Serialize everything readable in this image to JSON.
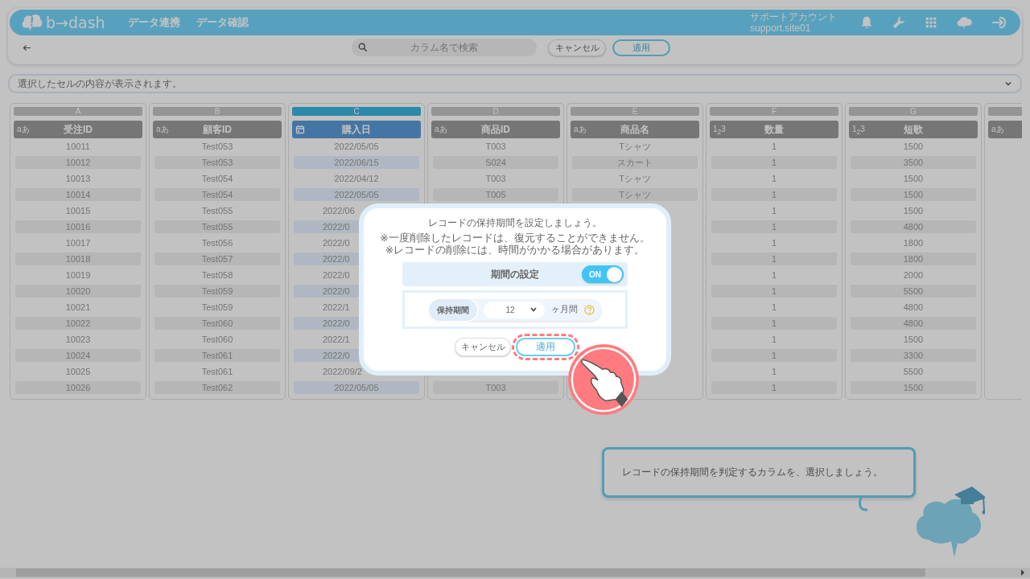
{
  "app_bar": {
    "logo": "b→dash",
    "nav": [
      {
        "label": "データ連携"
      },
      {
        "label": "データ確認"
      }
    ],
    "account": {
      "name": "サポートアカウント",
      "id": "support.site01"
    }
  },
  "toolbar": {
    "search": {
      "placeholder": "カラム名で検索"
    },
    "buttons": [
      {
        "label": "キャンセル",
        "kind": "secondary"
      },
      {
        "label": "適用",
        "kind": "primary"
      }
    ]
  },
  "cell_preview": {
    "placeholder": "選択したセルの内容が表示されます。"
  },
  "columns": [
    {
      "letter": "A",
      "name": "受注ID",
      "kind": "text",
      "type_label": "aあ",
      "selected": false,
      "cells": [
        "10011",
        "10012",
        "10013",
        "10014",
        "10015",
        "10016",
        "10017",
        "10018",
        "10019",
        "10020",
        "10021",
        "10022",
        "10023",
        "10024",
        "10025",
        "10026"
      ]
    },
    {
      "letter": "B",
      "name": "顧客ID",
      "kind": "text",
      "type_label": "aあ",
      "selected": false,
      "cells": [
        "Test053",
        "Test053",
        "Test054",
        "Test054",
        "Test055",
        "Test055",
        "Test056",
        "Test057",
        "Test058",
        "Test059",
        "Test059",
        "Test060",
        "Test060",
        "Test061",
        "Test061",
        "Test062"
      ]
    },
    {
      "letter": "C",
      "name": "購入日",
      "kind": "date",
      "selected": true,
      "cells": [
        "2022/05/05",
        "2022/06/15",
        "2022/04/12",
        "2022/05/05",
        {
          "text": "2022/06",
          "cut": true
        },
        {
          "text": "2022/0",
          "cut": true
        },
        {
          "text": "2022/0",
          "cut": true
        },
        {
          "text": "2022/0",
          "cut": true
        },
        {
          "text": "2022/0",
          "cut": true
        },
        {
          "text": "2022/0",
          "cut": true
        },
        {
          "text": "2022/1",
          "cut": true
        },
        {
          "text": "2022/0",
          "cut": true
        },
        {
          "text": "2022/1",
          "cut": true
        },
        {
          "text": "2022/0",
          "cut": true
        },
        {
          "text": "2022/09/2",
          "cut": true
        },
        "2022/05/05"
      ]
    },
    {
      "letter": "D",
      "name": "商品ID",
      "kind": "text",
      "type_label": "aあ",
      "selected": false,
      "cells": [
        "T003",
        "S024",
        "T003",
        "T005",
        null,
        null,
        null,
        null,
        null,
        null,
        null,
        null,
        null,
        null,
        null,
        "T003"
      ]
    },
    {
      "letter": "E",
      "name": "商品名",
      "kind": "text",
      "type_label": "aあ",
      "selected": false,
      "cells": [
        "Tシャツ",
        "スカート",
        "Tシャツ",
        "Tシャツ",
        null,
        null,
        null,
        null,
        null,
        null,
        null,
        null,
        null,
        null,
        null,
        null
      ]
    },
    {
      "letter": "F",
      "name": "数量",
      "kind": "number",
      "type_label": "1$_{2}$3",
      "selected": false,
      "cells": [
        "1",
        "1",
        "1",
        "1",
        "1",
        "1",
        "1",
        "1",
        "1",
        "1",
        "1",
        "1",
        "1",
        "1",
        "1",
        "1"
      ]
    },
    {
      "letter": "G",
      "name": "短歌",
      "kind": "number",
      "type_label": "1$_{2}$3",
      "selected": false,
      "cells": [
        "1500",
        "3500",
        "1500",
        "1500",
        "1500",
        "4800",
        "1800",
        "1800",
        "2000",
        "5500",
        "4800",
        "4800",
        "1500",
        "3300",
        "5500",
        "1500"
      ]
    },
    {
      "kind": "text",
      "type_label": "aあ",
      "selected": false
    }
  ],
  "dialog": {
    "title": "レコードの保持期間を設定しましょう。",
    "notes": [
      "※一度削除したレコードは、復元することができません。",
      "※レコードの削除には、時間がかかる場合があります。"
    ],
    "period_setting": {
      "label": "期間の設定",
      "on": true,
      "state_label": "ON"
    },
    "retention": {
      "label": "保持期間",
      "value": "12",
      "unit": "ヶ月間"
    },
    "buttons": [
      {
        "label": "キャンセル",
        "kind": "secondary",
        "highlighted": false
      },
      {
        "label": "適用",
        "kind": "primary",
        "highlighted": true
      }
    ]
  },
  "hint": {
    "text": "レコードの保持期間を判定するカラムを、選択しましょう。"
  }
}
